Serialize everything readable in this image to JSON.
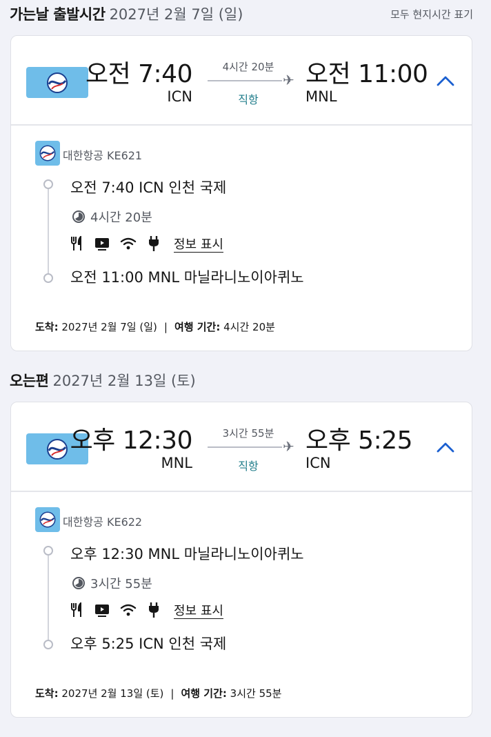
{
  "outbound": {
    "heading": "가는날 출발시간",
    "date": "2027년 2월 7일 (일)",
    "note": "모두 현지시간 표기",
    "dep_time": "오전 7:40",
    "dep_code": "ICN",
    "duration": "4시간 20분",
    "stops": "직항",
    "arr_time": "오전 11:00",
    "arr_code": "MNL",
    "airline": "대한항공 KE621",
    "seg_dep": "오전 7:40 ICN 인천 국제",
    "seg_duration": "4시간 20분",
    "info_link": "정보 표시",
    "seg_arr": "오전 11:00 MNL 마닐라니노이아퀴노",
    "arrive_label": "도착:",
    "arrive_date": "2027년 2월 7일 (일)",
    "sep": "|",
    "travel_label": "여행 기간:",
    "travel_time": "4시간 20분"
  },
  "inbound": {
    "heading": "오는편",
    "date": "2027년 2월 13일 (토)",
    "dep_time": "오후 12:30",
    "dep_code": "MNL",
    "duration": "3시간 55분",
    "stops": "직항",
    "arr_time": "오후 5:25",
    "arr_code": "ICN",
    "airline": "대한항공 KE622",
    "seg_dep": "오후 12:30 MNL 마닐라니노이아퀴노",
    "seg_duration": "3시간 55분",
    "info_link": "정보 표시",
    "seg_arr": "오후 5:25 ICN 인천 국제",
    "arrive_label": "도착:",
    "arrive_date": "2027년 2월 13일 (토)",
    "sep": "|",
    "travel_label": "여행 기간:",
    "travel_time": "3시간 55분"
  },
  "icons": {
    "airline_logo": "korean-air-logo",
    "plane": "plane-icon",
    "expand": "chevron-up-icon",
    "duration": "clock-icon",
    "meal": "meal-icon",
    "entertainment": "tv-icon",
    "wifi": "wifi-icon",
    "power": "power-plug-icon"
  },
  "colors": {
    "accent_blue": "#1a5fd0",
    "logo_bg": "#6fbde9",
    "stops_teal": "#1f7c8a"
  }
}
